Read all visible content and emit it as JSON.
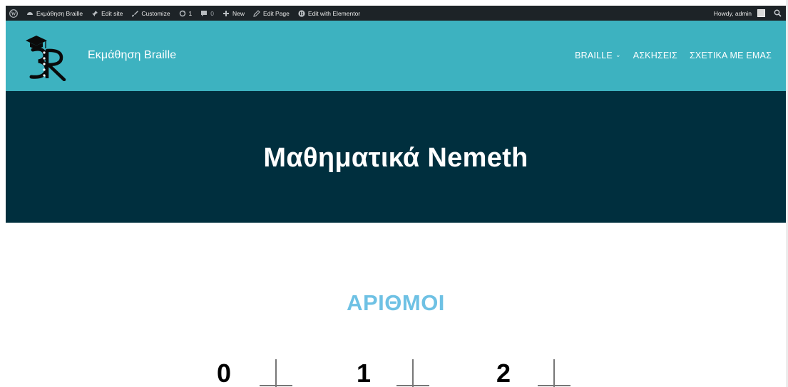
{
  "admin_bar": {
    "site_name": "Εκμάθηση Braille",
    "edit_site": "Edit site",
    "customize": "Customize",
    "updates_count": "1",
    "comments_count": "0",
    "new": "New",
    "edit_page": "Edit Page",
    "edit_elementor": "Edit with Elementor",
    "howdy": "Howdy, admin"
  },
  "header": {
    "site_title": "Εκμάθηση Braille",
    "menu": [
      {
        "label": "BRAILLE",
        "has_dropdown": true
      },
      {
        "label": "ΑΣΚΗΣΕΙΣ"
      },
      {
        "label": "ΣΧΕΤΙΚΑ ΜΕ ΕΜΑΣ"
      }
    ]
  },
  "hero": {
    "title": "Μαθηματικά Nemeth"
  },
  "content": {
    "section_title": "ΑΡΙΘΜΟΙ",
    "numbers": [
      "0",
      "1",
      "2"
    ]
  },
  "colors": {
    "admin_bar": "#1d2327",
    "header": "#3db2c0",
    "hero": "#002f3e",
    "section_title": "#6ec1e4"
  },
  "icons": [
    "wordpress-icon",
    "dashboard-icon",
    "pin-icon",
    "brush-icon",
    "updates-icon",
    "comment-icon",
    "plus-icon",
    "pencil-icon",
    "elementor-icon",
    "search-icon",
    "chevron-down-icon"
  ]
}
